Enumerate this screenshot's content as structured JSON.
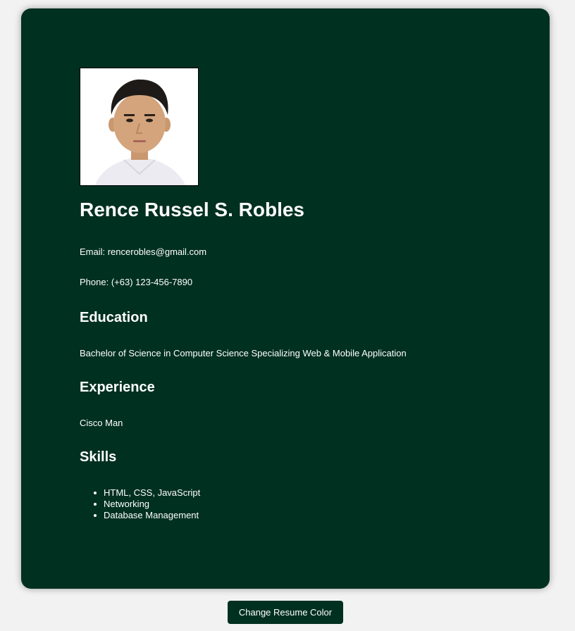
{
  "resume": {
    "name": "Rence Russel S. Robles",
    "email_line": "Email: rencerobles@gmail.com",
    "phone_line": "Phone: (+63) 123-456-7890",
    "education": {
      "heading": "Education",
      "text": "Bachelor of Science in Computer Science Specializing Web & Mobile Application"
    },
    "experience": {
      "heading": "Experience",
      "text": "Cisco Man"
    },
    "skills": {
      "heading": "Skills",
      "items": [
        "HTML, CSS, JavaScript",
        "Networking",
        "Database Management"
      ]
    }
  },
  "actions": {
    "change_color_label": "Change Resume Color"
  },
  "colors": {
    "card_background": "#003020",
    "page_background": "#f2f2f2",
    "text": "#ffffff"
  }
}
